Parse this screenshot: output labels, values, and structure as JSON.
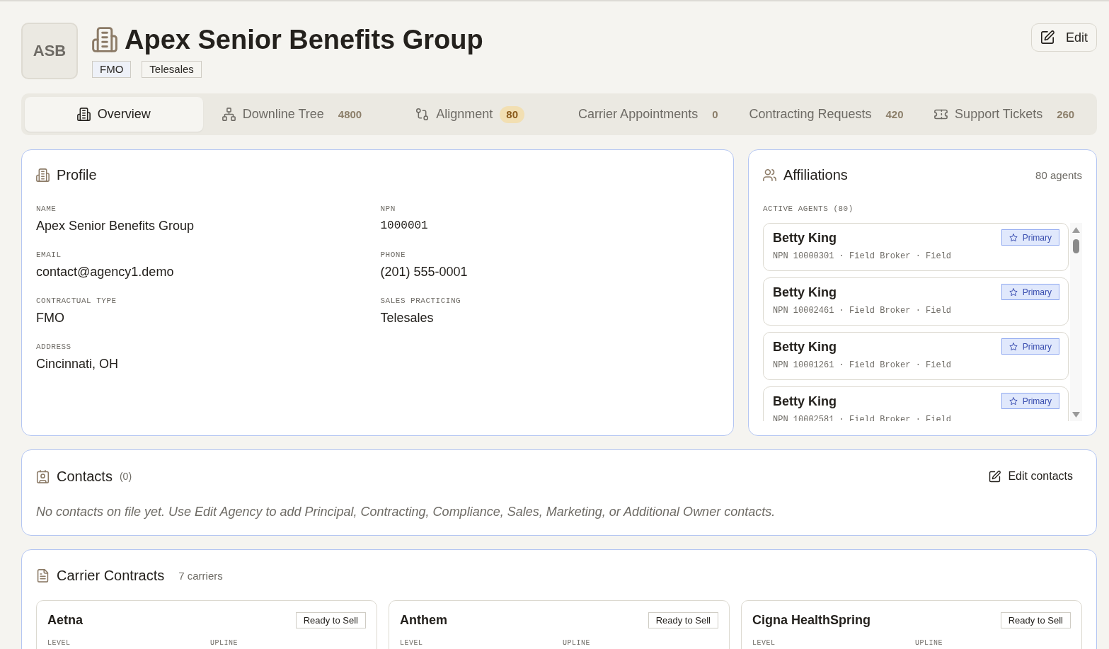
{
  "header": {
    "avatar": "ASB",
    "title": "Apex Senior Benefits Group",
    "tags": [
      {
        "label": "FMO",
        "color": "#eef1f8"
      },
      {
        "label": "Telesales",
        "color": "#f6f5f1"
      }
    ],
    "edit_button": "Edit"
  },
  "tabs": [
    {
      "label": "Overview",
      "selected": true
    },
    {
      "label": "Downline Tree",
      "selected": false,
      "count": "4800",
      "count_highlighted": false
    },
    {
      "label": "Alignment",
      "selected": false,
      "count": "80",
      "count_highlighted": true
    },
    {
      "label": "Carrier Appointments",
      "selected": false,
      "count": "0",
      "count_highlighted": false
    },
    {
      "label": "Contracting Requests",
      "selected": false,
      "count": "420",
      "count_highlighted": false
    },
    {
      "label": "Support Tickets",
      "selected": false,
      "count": "260",
      "count_highlighted": false
    }
  ],
  "profile": {
    "title": "Profile",
    "fields": [
      {
        "label": "NAME",
        "value": "Apex Senior Benefits Group",
        "kind": "text"
      },
      {
        "label": "NPN",
        "value": "1000001",
        "kind": "mono"
      },
      {
        "label": "EMAIL",
        "value": "contact@agency1.demo",
        "kind": "text"
      },
      {
        "label": "PHONE",
        "value": "(201) 555-0001",
        "kind": "text"
      },
      {
        "label": "CONTRACTUAL TYPE",
        "value": "FMO",
        "kind": "text"
      },
      {
        "label": "SALES PRACTICING",
        "value": "Telesales",
        "kind": "text"
      },
      {
        "label": "ADDRESS",
        "value": "Cincinnati, OH",
        "kind": "text"
      }
    ]
  },
  "affiliations": {
    "title": "Affiliations",
    "count": "80 agents",
    "list_label": "ACTIVE AGENTS (80)",
    "agents": [
      {
        "name": "Betty King",
        "details": "NPN 10000301 · Field Broker · Field",
        "badge": "Primary"
      },
      {
        "name": "Betty King",
        "details": "NPN 10002461 · Field Broker · Field",
        "badge": "Primary"
      },
      {
        "name": "Betty King",
        "details": "NPN 10001261 · Field Broker · Field",
        "badge": "Primary"
      },
      {
        "name": "Betty King",
        "details": "NPN 10002581 · Field Broker · Field",
        "badge": "Primary"
      }
    ]
  },
  "contacts": {
    "title": "Contacts",
    "count": "(0)",
    "edit_button": "Edit contacts",
    "empty_text": "No contacts on file yet. Use Edit Agency to add Principal, Contracting, Compliance, Sales, Marketing, or Additional Owner contacts."
  },
  "carrier_contracts": {
    "title": "Carrier Contracts",
    "count": "7 carriers",
    "carriers": [
      {
        "name": "Aetna",
        "status": "Ready to Sell",
        "column_labels": [
          "LEVEL",
          "UPLINE"
        ]
      },
      {
        "name": "Anthem",
        "status": "Ready to Sell",
        "column_labels": [
          "LEVEL",
          "UPLINE"
        ]
      },
      {
        "name": "Cigna HealthSpring",
        "status": "Ready to Sell",
        "column_labels": [
          "LEVEL",
          "UPLINE"
        ]
      }
    ]
  }
}
